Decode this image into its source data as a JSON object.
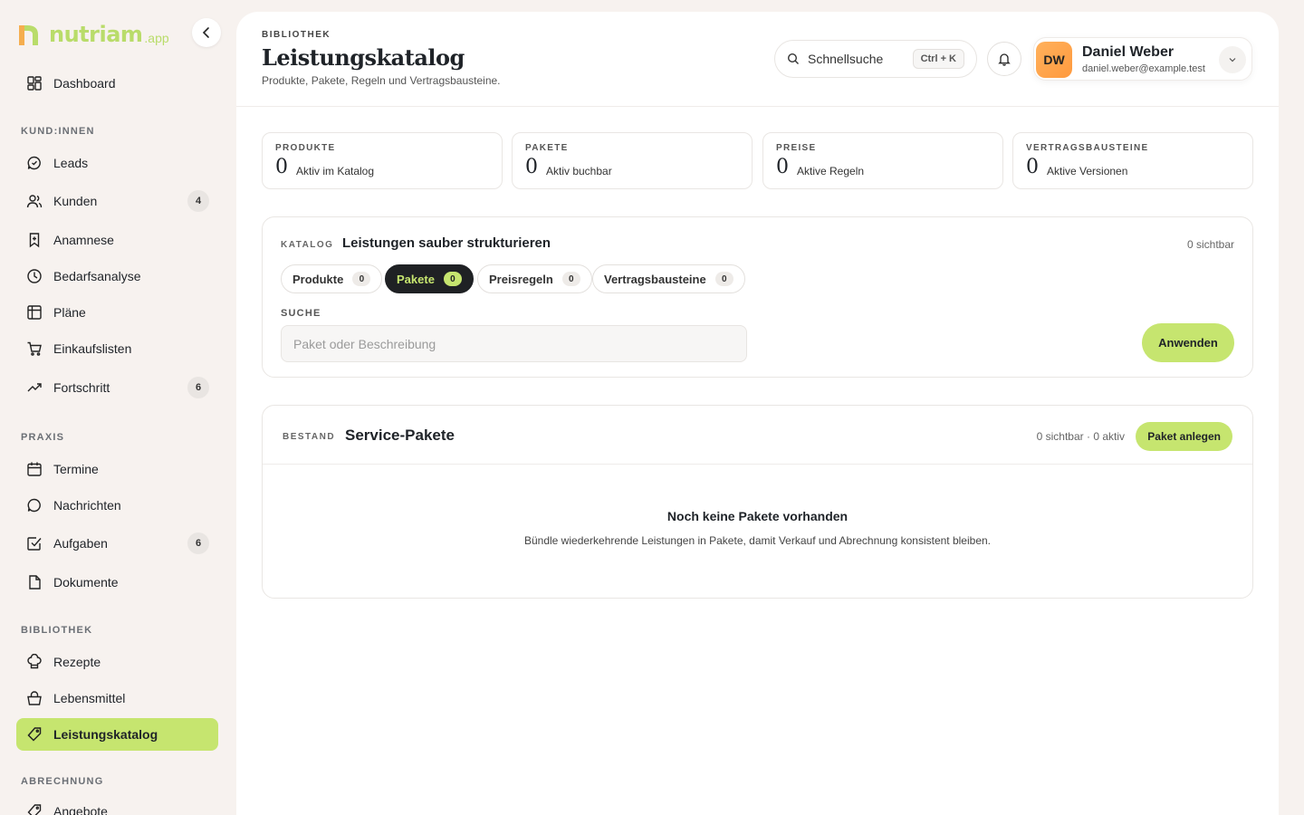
{
  "brand": {
    "name": "nutriam",
    "suffix": ".app"
  },
  "sidebar": {
    "items": [
      {
        "label": "Dashboard"
      },
      {
        "label": "Leads"
      },
      {
        "label": "Kunden",
        "badge": "4"
      },
      {
        "label": "Anamnese"
      },
      {
        "label": "Bedarfsanalyse"
      },
      {
        "label": "Pläne"
      },
      {
        "label": "Einkaufslisten"
      },
      {
        "label": "Fortschritt",
        "badge": "6"
      },
      {
        "label": "Termine"
      },
      {
        "label": "Nachrichten"
      },
      {
        "label": "Aufgaben",
        "badge": "6"
      },
      {
        "label": "Dokumente"
      },
      {
        "label": "Rezepte"
      },
      {
        "label": "Lebensmittel"
      },
      {
        "label": "Leistungskatalog"
      },
      {
        "label": "Angebote"
      }
    ],
    "sections": [
      "KUND:INNEN",
      "PRAXIS",
      "BIBLIOTHEK",
      "ABRECHNUNG"
    ]
  },
  "header": {
    "eyebrow": "BIBLIOTHEK",
    "title": "Leistungskatalog",
    "subtitle": "Produkte, Pakete, Regeln und Vertragsbausteine.",
    "search_label": "Schnellsuche",
    "shortcut": "Ctrl + K"
  },
  "user": {
    "initials": "DW",
    "name": "Daniel Weber",
    "email": "daniel.weber@example.test"
  },
  "stats": [
    {
      "label": "PRODUKTE",
      "value": "0",
      "desc": "Aktiv im Katalog"
    },
    {
      "label": "PAKETE",
      "value": "0",
      "desc": "Aktiv buchbar"
    },
    {
      "label": "PREISE",
      "value": "0",
      "desc": "Aktive Regeln"
    },
    {
      "label": "VERTRAGSBAUSTEINE",
      "value": "0",
      "desc": "Aktive Versionen"
    }
  ],
  "catalog": {
    "eyebrow": "KATALOG",
    "title": "Leistungen sauber strukturieren",
    "visible": "0 sichtbar",
    "tabs": [
      {
        "label": "Produkte",
        "count": "0"
      },
      {
        "label": "Pakete",
        "count": "0"
      },
      {
        "label": "Preisregeln",
        "count": "0"
      },
      {
        "label": "Vertragsbausteine",
        "count": "0"
      }
    ],
    "search_label": "SUCHE",
    "search_placeholder": "Paket oder Beschreibung",
    "apply_label": "Anwenden"
  },
  "inventory": {
    "eyebrow": "BESTAND",
    "title": "Service-Pakete",
    "meta": "0 sichtbar · 0 aktiv",
    "add_label": "Paket anlegen",
    "empty_title": "Noch keine Pakete vorhanden",
    "empty_desc": "Bündle wiederkehrende Leistungen in Pakete, damit Verkauf und Abrechnung konsistent bleiben."
  },
  "colors": {
    "accent": "#c6e56f",
    "dark": "#1f2124",
    "avatar": "#ffa64a"
  }
}
